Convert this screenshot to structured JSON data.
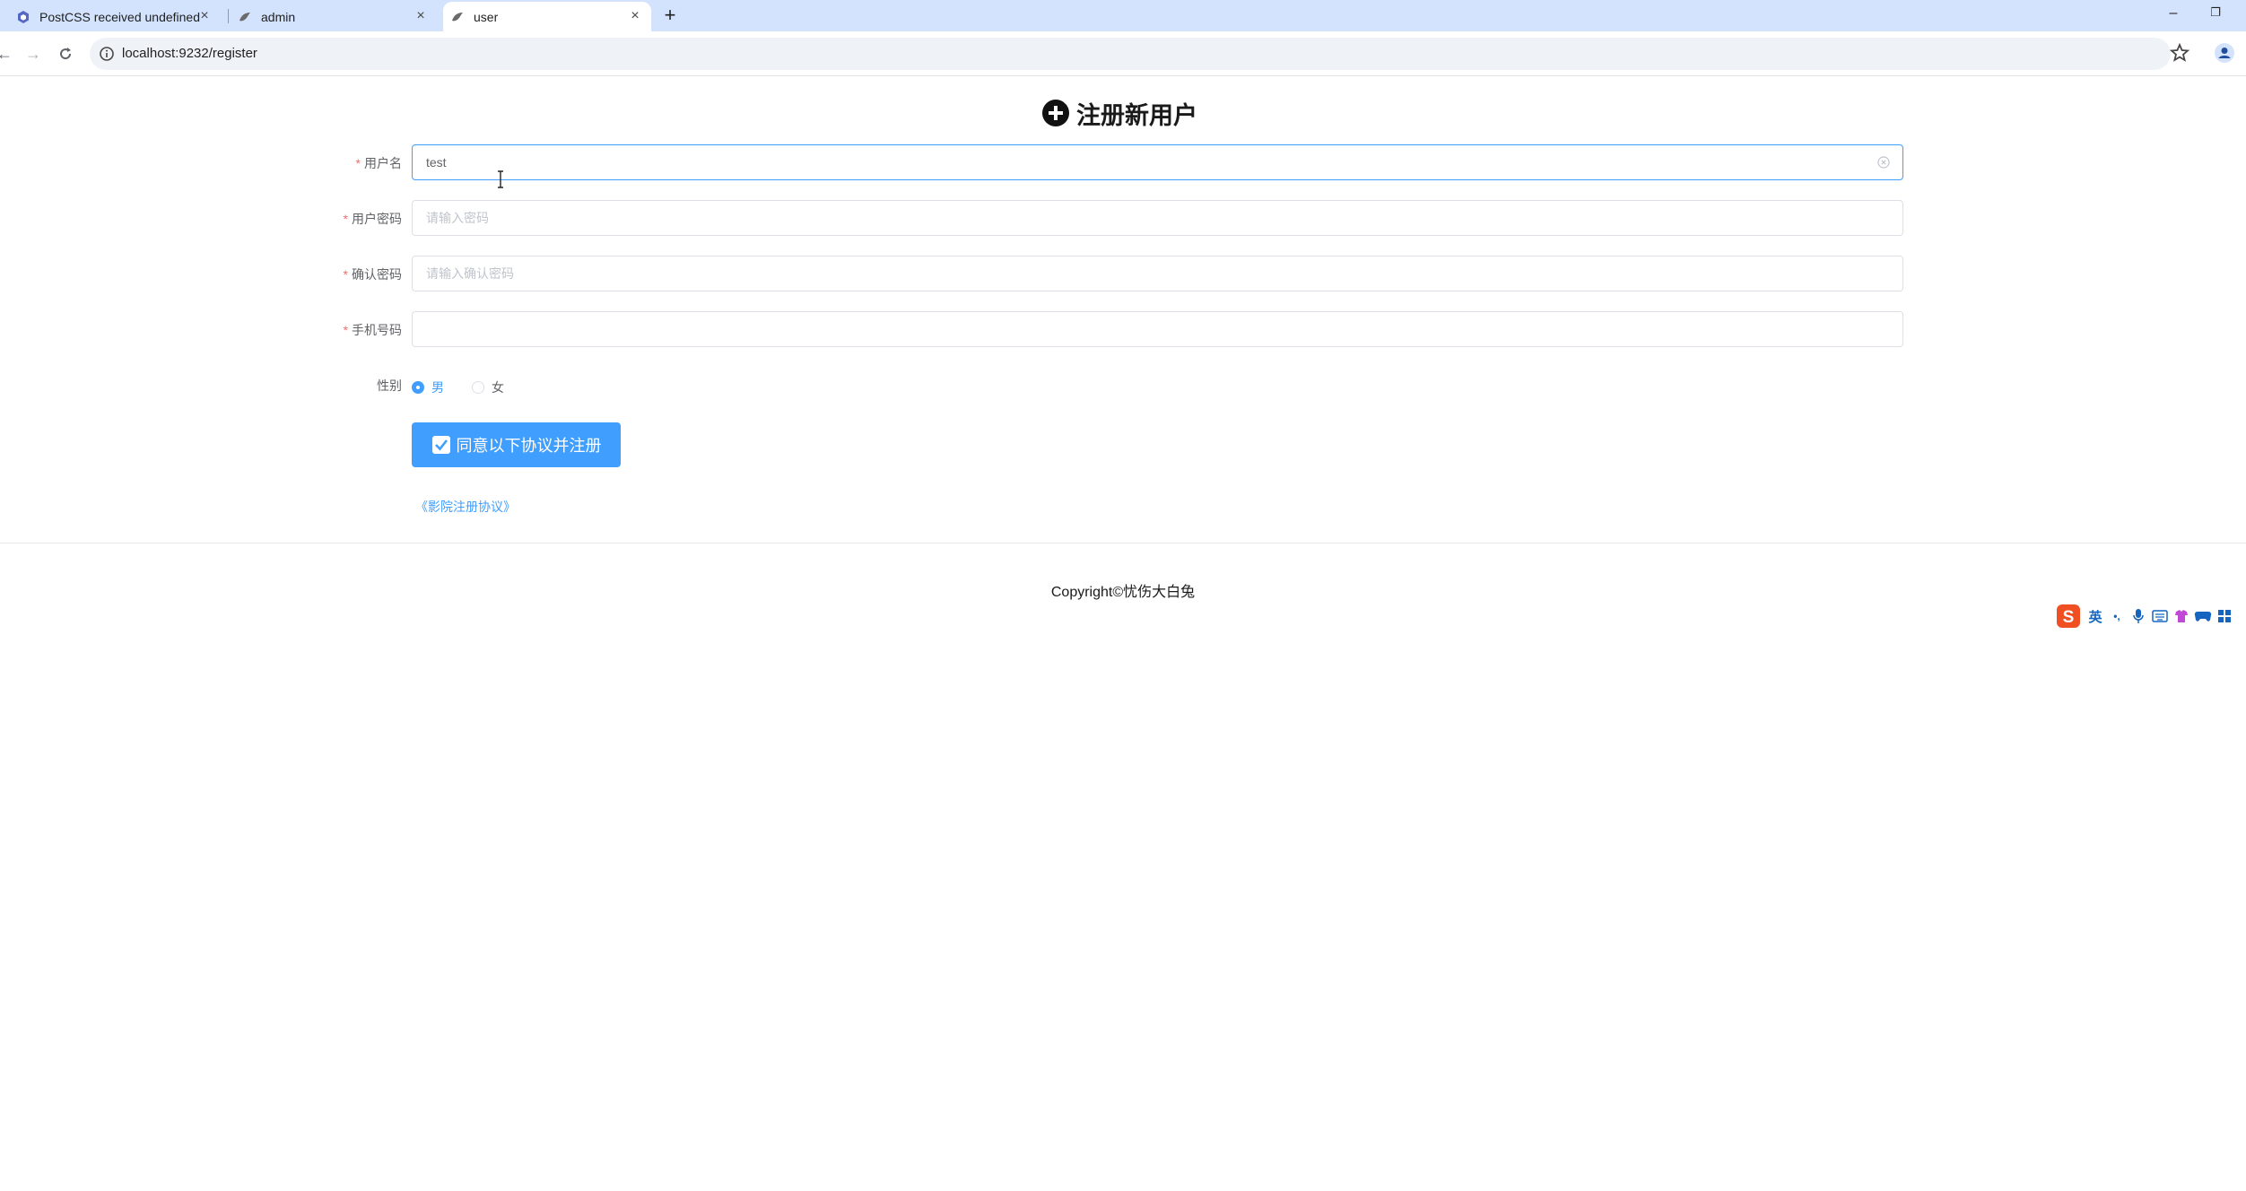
{
  "browser": {
    "tabs": [
      {
        "title": "PostCSS received undefined",
        "active": false
      },
      {
        "title": "admin",
        "active": false
      },
      {
        "title": "user",
        "active": true
      }
    ],
    "url": "localhost:9232/register",
    "window_controls": {
      "minimize": "–",
      "restore": "❐"
    }
  },
  "page": {
    "title": "注册新用户",
    "form": {
      "username": {
        "label": "用户名",
        "value": "test",
        "placeholder": ""
      },
      "password": {
        "label": "用户密码",
        "value": "",
        "placeholder": "请输入密码"
      },
      "confirm_password": {
        "label": "确认密码",
        "value": "",
        "placeholder": "请输入确认密码"
      },
      "phone": {
        "label": "手机号码",
        "value": "",
        "placeholder": ""
      },
      "gender": {
        "label": "性别",
        "options": [
          "男",
          "女"
        ],
        "selected": "男"
      },
      "required_mark": "*"
    },
    "submit_label": "同意以下协议并注册",
    "agreement_link": "《影院注册协议》",
    "copyright": "Copyright©忧伤大白兔"
  },
  "ime": {
    "mode_label": "英",
    "punct": "•,"
  },
  "colors": {
    "primary": "#409eff",
    "required": "#f56c6c",
    "tabbar": "#d3e3fd"
  }
}
